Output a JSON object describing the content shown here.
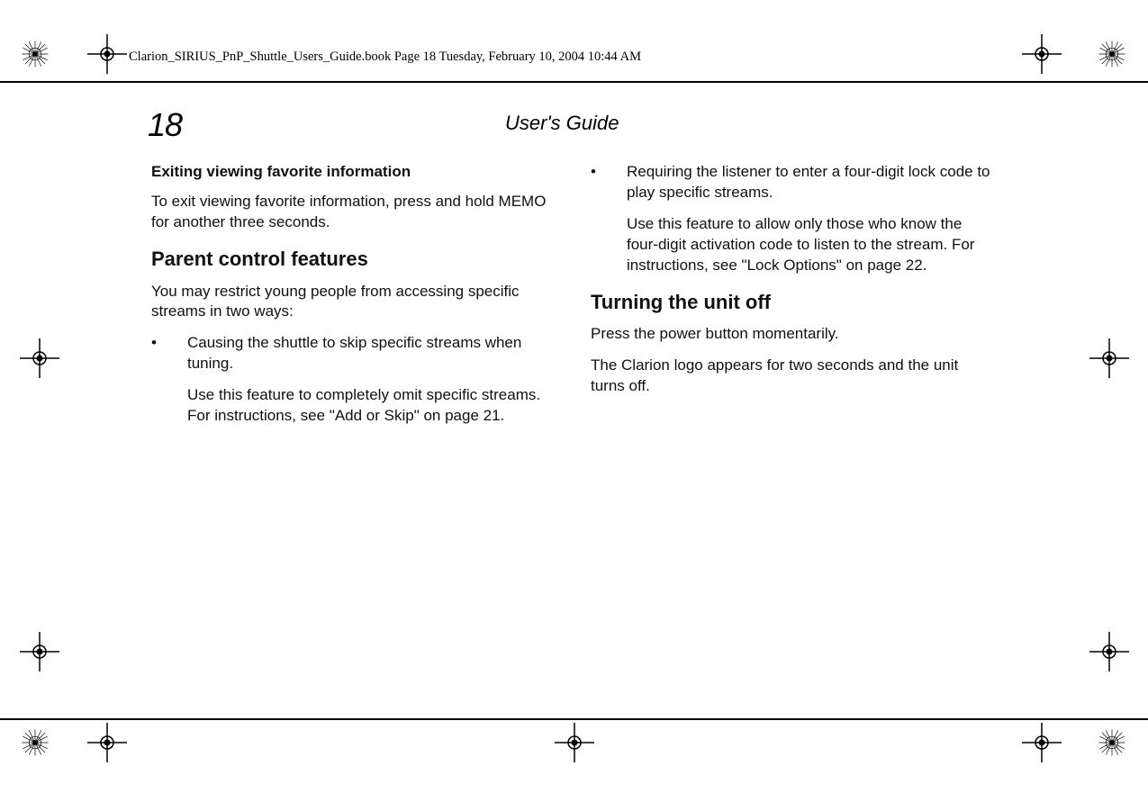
{
  "header": {
    "runhead": "Clarion_SIRIUS_PnP_Shuttle_Users_Guide.book  Page 18  Tuesday, February 10, 2004  10:44 AM"
  },
  "page": {
    "number": "18",
    "title": "User's Guide"
  },
  "col1": {
    "h3_exit": "Exiting viewing favorite information",
    "p_exit": "To exit viewing favorite information, press and hold MEMO for another three seconds.",
    "h2_parent": "Parent control features",
    "p_parent_intro": "You may restrict young people from accessing specific streams in two ways:",
    "bullet1_main": "Causing the shuttle to skip specific streams when tuning.",
    "bullet1_sub": "Use this feature to completely omit specific streams. For instructions, see \"Add or Skip\" on page 21."
  },
  "col2": {
    "bullet2_main": "Requiring the listener to enter a four-digit lock code to play specific streams.",
    "bullet2_sub": "Use this feature to allow only those who know the four-digit activation code to listen to the stream. For instructions, see \"Lock Options\" on page 22.",
    "h2_off": "Turning the unit off",
    "p_off1": "Press the power button momentarily.",
    "p_off2": "The Clarion logo appears for two seconds and the unit turns off."
  },
  "glyphs": {
    "bullet": "•"
  }
}
